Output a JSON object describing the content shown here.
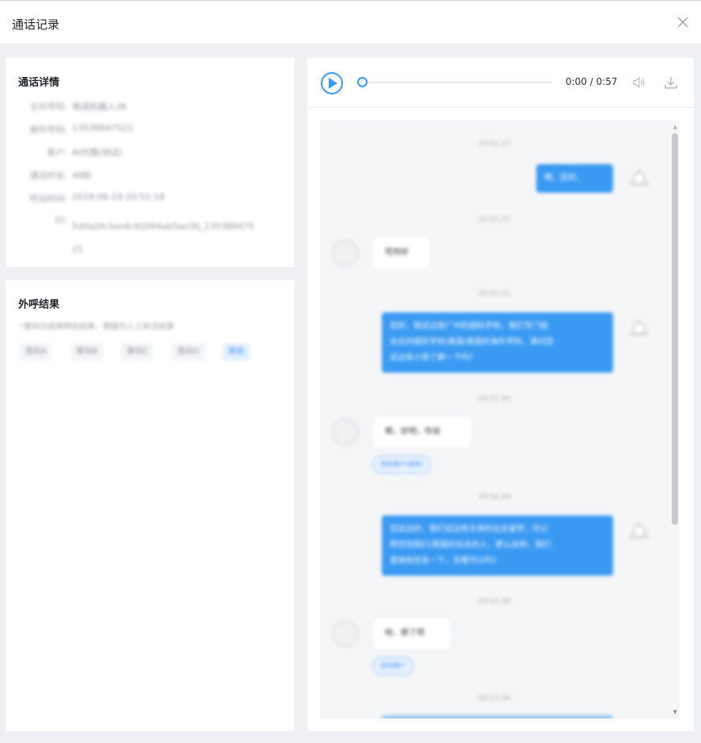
{
  "window": {
    "title": "通话记录",
    "close_icon": "close-icon"
  },
  "detail": {
    "title": "通话详情",
    "rows": [
      {
        "label": "主叫号码:",
        "value": "电话机器人36"
      },
      {
        "label": "被叫号码:",
        "value": "13538847521"
      },
      {
        "label": "客户:",
        "value": "AI代理(测试)"
      },
      {
        "label": "通话时长:",
        "value": "49秒"
      },
      {
        "label": "呼出时间:",
        "value": "2019-06-19 20:51:18"
      },
      {
        "label": "ID:",
        "value": "5d0a2fc3ee4c92094ab5ae3b_13538847521"
      }
    ]
  },
  "result": {
    "title": "外呼结果",
    "description": "*意向为成单转化结果，根据为人工标注结果",
    "tags": [
      "意向A",
      "意向B",
      "意向C",
      "意向D",
      "其他"
    ],
    "active_tag_index": 4
  },
  "player": {
    "time_display": "0:00 / 0:57",
    "progress": 0,
    "accent_color": "#3a9af2"
  },
  "chat": {
    "timestamps": [
      "20:51:27",
      "20:51:31",
      "20:51:31",
      "20:51:44",
      "20:51:45",
      "20:51:58",
      "20:51:58"
    ],
    "messages": [
      {
        "side": "right",
        "text": "喂，您好。"
      },
      {
        "side": "left",
        "text": "哎你好"
      },
      {
        "side": "right",
        "lines": [
          "您好，我这边是广州的国际学校，我们专门给",
          "出去的国际学校/美国/英国的海外学科，请问您",
          "这边有小孩了解一下吗?"
        ]
      },
      {
        "side": "left",
        "text": "嗯，好吧，你说",
        "intent": "意向用户(成单)"
      },
      {
        "side": "right",
        "lines": [
          "您这边好，我们这边有全英的出去留学，可以",
          "帮您找我们/英国的出去的人，那么这样，我们",
          "直接给您发一下，您看可以吗?"
        ]
      },
      {
        "side": "left",
        "text": "哈，那了吧",
        "intent": "意向用户"
      }
    ]
  }
}
